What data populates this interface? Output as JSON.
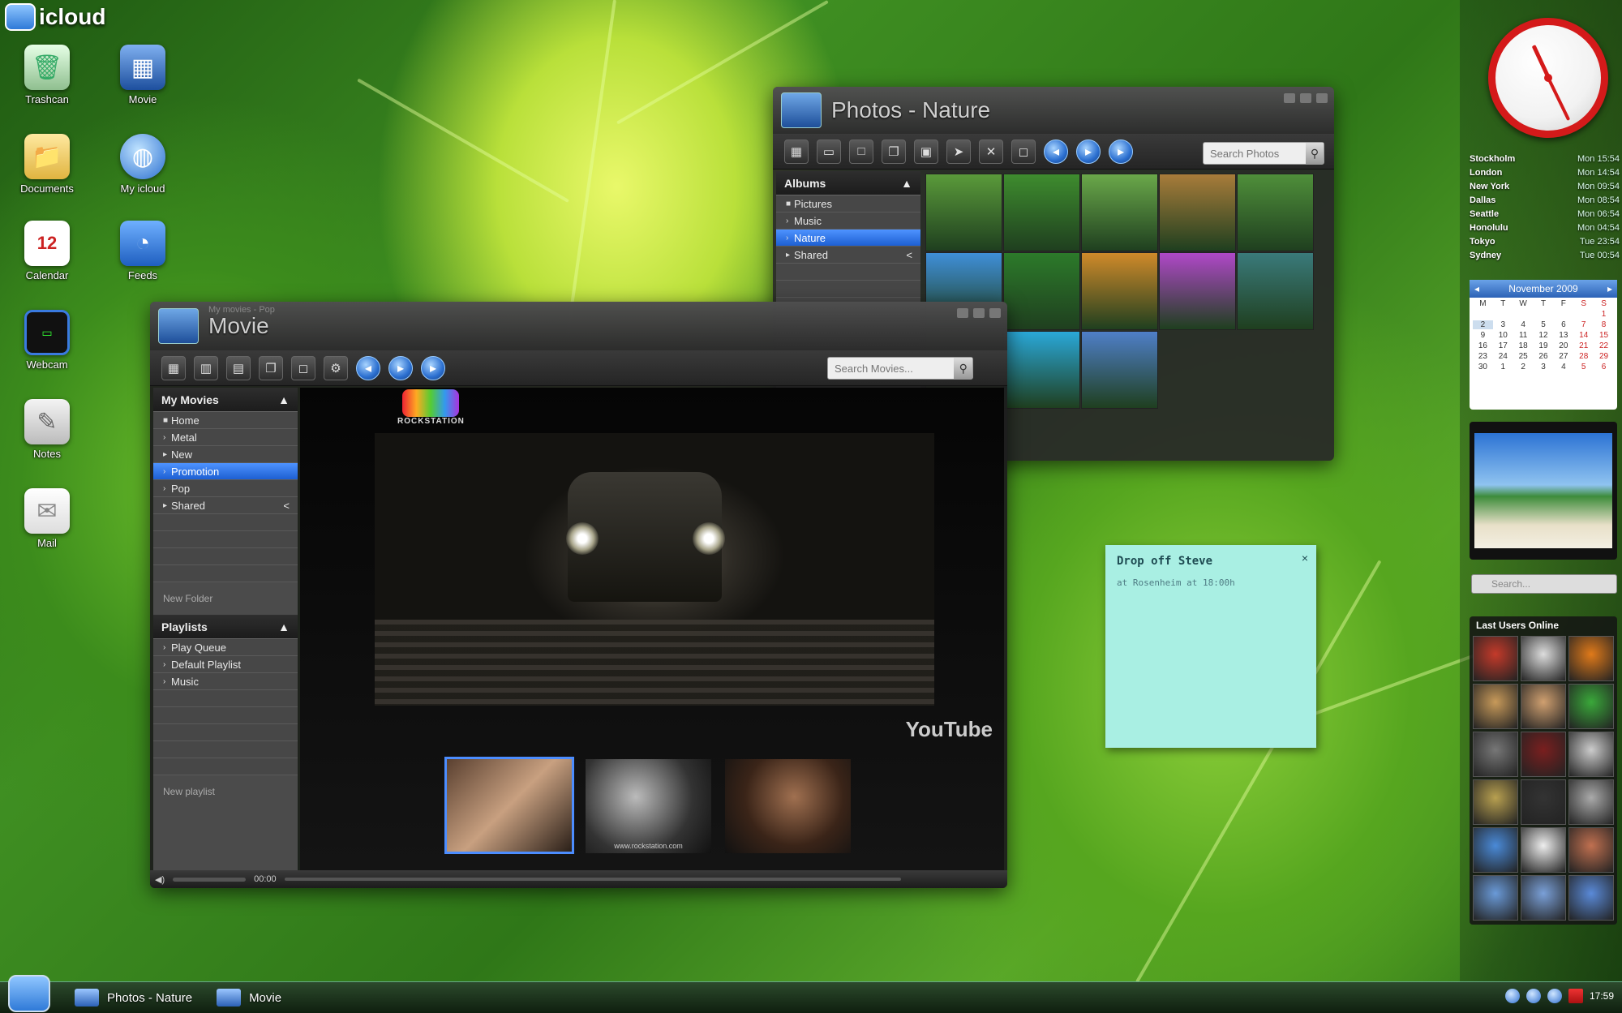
{
  "desktop": {
    "logo_text": "icloud",
    "icons": [
      {
        "label": "Trashcan",
        "glyph": "trash-icon"
      },
      {
        "label": "Movie",
        "glyph": "movie-icon"
      },
      {
        "label": "Documents",
        "glyph": "folder-icon"
      },
      {
        "label": "My icloud",
        "glyph": "globe-icon"
      },
      {
        "label": "Calendar",
        "glyph": "calendar-icon"
      },
      {
        "label": "Feeds",
        "glyph": "rss-icon"
      },
      {
        "label": "Webcam",
        "glyph": "monitor-icon"
      },
      {
        "label": "Notes",
        "glyph": "notes-icon"
      },
      {
        "label": "Mail",
        "glyph": "mail-icon"
      }
    ]
  },
  "photos_window": {
    "title": "Photos - Nature",
    "search_placeholder": "Search Photos",
    "sidebar": {
      "header": "Albums",
      "items": [
        {
          "label": "Pictures",
          "selected": false
        },
        {
          "label": "Music",
          "selected": false
        },
        {
          "label": "Nature",
          "selected": true
        },
        {
          "label": "Shared",
          "selected": false
        }
      ]
    },
    "photos": [
      "#5a9a3a",
      "#3e8c2e",
      "#6aa84a",
      "#a87c3a",
      "#4f8f3a",
      "#3f8fd8",
      "#2c7a2a",
      "#d08a2a",
      "#b048c8",
      "#3a7a7a",
      "#3c8a2c",
      "#2aa8d8",
      "#4f7fc8"
    ]
  },
  "movie_window": {
    "title": "Movie",
    "subtitle": "My movies - Pop",
    "search_placeholder": "Search Movies...",
    "brand": "ROCKSTATION",
    "youtube_label": "YouTube",
    "time": "00:00",
    "thumb_caption": "www.rockstation.com",
    "sidebar": {
      "header": "My Movies",
      "items": [
        {
          "label": "Home",
          "selected": false
        },
        {
          "label": "Metal",
          "selected": false
        },
        {
          "label": "New",
          "selected": false
        },
        {
          "label": "Promotion",
          "selected": true
        },
        {
          "label": "Pop",
          "selected": false
        },
        {
          "label": "Shared",
          "selected": false
        }
      ],
      "new_folder": "New Folder",
      "playlists_header": "Playlists",
      "playlists": [
        {
          "label": "Play Queue"
        },
        {
          "label": "Default Playlist"
        },
        {
          "label": "Music"
        }
      ],
      "new_playlist": "New playlist"
    }
  },
  "sticky_note": {
    "title": "Drop off Steve",
    "body": "at Rosenheim at 18:00h"
  },
  "world_clock": [
    {
      "city": "Stockholm",
      "time": "Mon 15:54"
    },
    {
      "city": "London",
      "time": "Mon 14:54"
    },
    {
      "city": "New York",
      "time": "Mon 09:54"
    },
    {
      "city": "Dallas",
      "time": "Mon 08:54"
    },
    {
      "city": "Seattle",
      "time": "Mon 06:54"
    },
    {
      "city": "Honolulu",
      "time": "Mon 04:54"
    },
    {
      "city": "Tokyo",
      "time": "Tue 23:54"
    },
    {
      "city": "Sydney",
      "time": "Tue 00:54"
    }
  ],
  "calendar": {
    "month": "November 2009",
    "weekdays": [
      "M",
      "T",
      "W",
      "T",
      "F",
      "S",
      "S"
    ],
    "days": [
      "",
      "",
      "",
      "",
      "",
      "",
      "1",
      "2",
      "3",
      "4",
      "5",
      "6",
      "7",
      "8",
      "9",
      "10",
      "11",
      "12",
      "13",
      "14",
      "15",
      "16",
      "17",
      "18",
      "19",
      "20",
      "21",
      "22",
      "23",
      "24",
      "25",
      "26",
      "27",
      "28",
      "29",
      "30",
      "1",
      "2",
      "3",
      "4",
      "5",
      "6"
    ]
  },
  "gadget_search_placeholder": "Search...",
  "users_panel": {
    "title": "Last Users Online",
    "avatars": [
      "#c43a2a",
      "#ddd",
      "#e07a1a",
      "#c89a5a",
      "#d0a070",
      "#3aa83a",
      "#777",
      "#7a1f1f",
      "#ccc",
      "#b8a050",
      "#333",
      "#aaa",
      "#4a8ad8",
      "#eee",
      "#c07050",
      "#6a9ad8",
      "#7aa0d8",
      "#5a8ad8"
    ]
  },
  "taskbar": {
    "items": [
      {
        "label": "Photos - Nature"
      },
      {
        "label": "Movie"
      }
    ],
    "time": "17:59"
  }
}
